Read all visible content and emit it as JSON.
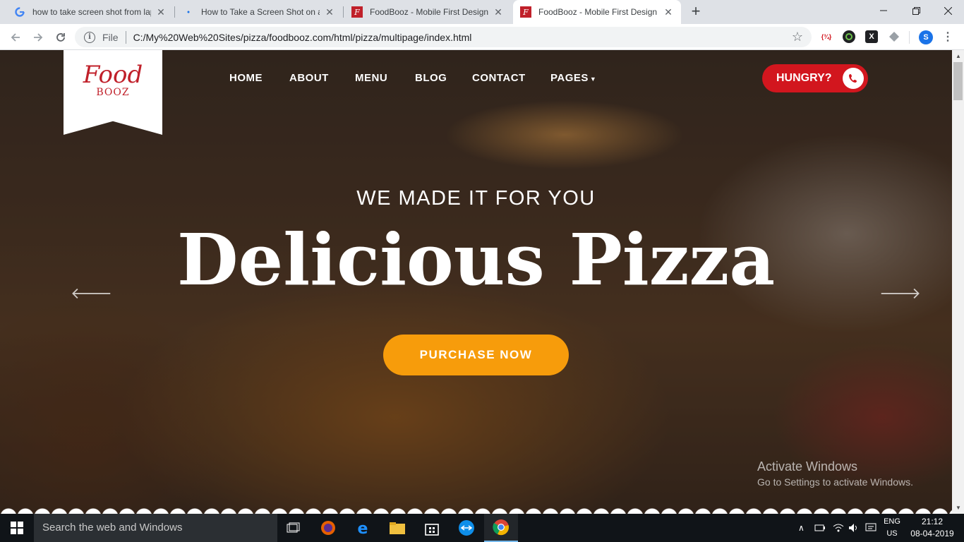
{
  "browser": {
    "tabs": [
      {
        "title": "how to take screen shot from lap",
        "favicon": "google-icon",
        "active": false
      },
      {
        "title": "How to Take a Screen Shot on a W",
        "favicon": "loading-icon",
        "active": false
      },
      {
        "title": "FoodBooz - Mobile First Design",
        "favicon": "foodbooz-icon",
        "active": false
      },
      {
        "title": "FoodBooz - Mobile First Design",
        "favicon": "foodbooz-icon",
        "active": true
      }
    ],
    "omnibox": {
      "protocol_label": "File",
      "url": "C:/My%20Web%20Sites/pizza/foodbooz.com/html/pizza/multipage/index.html"
    },
    "profile_initial": "S"
  },
  "site": {
    "logo": {
      "line1": "Food",
      "line2": "BOOZ"
    },
    "nav": {
      "home": "HOME",
      "about": "ABOUT",
      "menu": "MENU",
      "blog": "BLOG",
      "contact": "CONTACT",
      "pages": "PAGES"
    },
    "hungry_label": "HUNGRY?",
    "hero": {
      "subheading": "WE MADE IT FOR YOU",
      "heading": "Delicious Pizza",
      "cta": "PURCHASE NOW"
    },
    "watermark": {
      "title": "Activate Windows",
      "subtitle": "Go to Settings to activate Windows."
    }
  },
  "taskbar": {
    "search_placeholder": "Search the web and Windows",
    "lang_top": "ENG",
    "lang_bottom": "US",
    "time": "21:12",
    "date": "08-04-2019"
  },
  "colors": {
    "brand_red": "#d2161e",
    "cta_orange": "#f79c0b",
    "logo_red": "#c0202a"
  }
}
